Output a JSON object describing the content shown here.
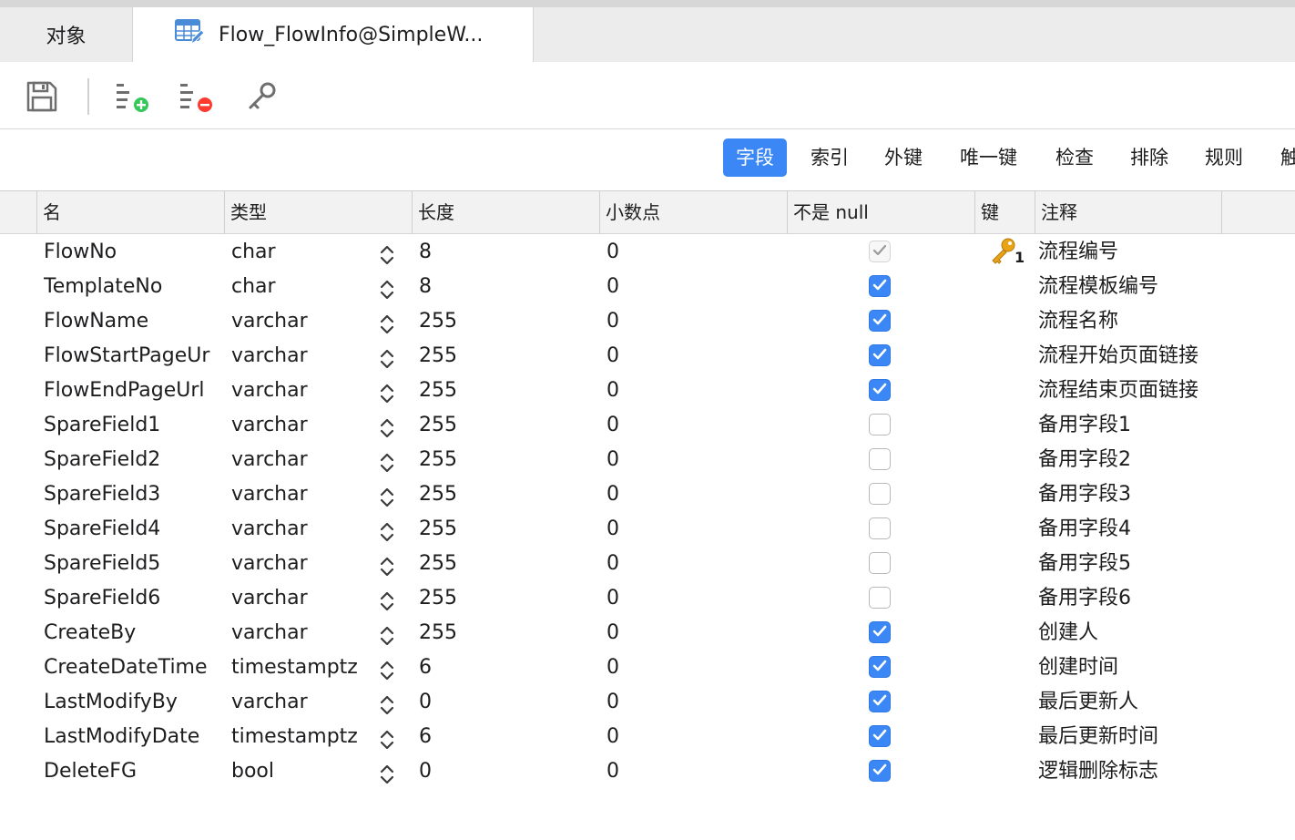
{
  "tabs": [
    {
      "label": "对象",
      "icon": "none"
    },
    {
      "label": "Flow_FlowInfo@SimpleW...",
      "icon": "table-edit-icon"
    }
  ],
  "toolbar": {
    "buttons": [
      {
        "name": "save-button",
        "icon": "save-icon"
      },
      {
        "name": "add-field-button",
        "icon": "add-field-icon"
      },
      {
        "name": "delete-field-button",
        "icon": "delete-field-icon"
      },
      {
        "name": "primary-key-button",
        "icon": "key-icon"
      }
    ]
  },
  "segments": [
    {
      "label": "字段",
      "active": true
    },
    {
      "label": "索引",
      "active": false
    },
    {
      "label": "外键",
      "active": false
    },
    {
      "label": "唯一键",
      "active": false
    },
    {
      "label": "检查",
      "active": false
    },
    {
      "label": "排除",
      "active": false
    },
    {
      "label": "规则",
      "active": false
    },
    {
      "label": "触",
      "active": false
    }
  ],
  "columns": [
    "名",
    "类型",
    "长度",
    "小数点",
    "不是 null",
    "键",
    "注释"
  ],
  "rows": [
    {
      "name": "FlowNo",
      "type": "char",
      "length": "8",
      "decimals": "0",
      "not_null": "disabled",
      "key": "1",
      "comment": "流程编号"
    },
    {
      "name": "TemplateNo",
      "type": "char",
      "length": "8",
      "decimals": "0",
      "not_null": "on",
      "key": "",
      "comment": "流程模板编号"
    },
    {
      "name": "FlowName",
      "type": "varchar",
      "length": "255",
      "decimals": "0",
      "not_null": "on",
      "key": "",
      "comment": "流程名称"
    },
    {
      "name": "FlowStartPageUr",
      "type": "varchar",
      "length": "255",
      "decimals": "0",
      "not_null": "on",
      "key": "",
      "comment": "流程开始页面链接"
    },
    {
      "name": "FlowEndPageUrl",
      "type": "varchar",
      "length": "255",
      "decimals": "0",
      "not_null": "on",
      "key": "",
      "comment": "流程结束页面链接"
    },
    {
      "name": "SpareField1",
      "type": "varchar",
      "length": "255",
      "decimals": "0",
      "not_null": "off",
      "key": "",
      "comment": "备用字段1"
    },
    {
      "name": "SpareField2",
      "type": "varchar",
      "length": "255",
      "decimals": "0",
      "not_null": "off",
      "key": "",
      "comment": "备用字段2"
    },
    {
      "name": "SpareField3",
      "type": "varchar",
      "length": "255",
      "decimals": "0",
      "not_null": "off",
      "key": "",
      "comment": "备用字段3"
    },
    {
      "name": "SpareField4",
      "type": "varchar",
      "length": "255",
      "decimals": "0",
      "not_null": "off",
      "key": "",
      "comment": "备用字段4"
    },
    {
      "name": "SpareField5",
      "type": "varchar",
      "length": "255",
      "decimals": "0",
      "not_null": "off",
      "key": "",
      "comment": "备用字段5"
    },
    {
      "name": "SpareField6",
      "type": "varchar",
      "length": "255",
      "decimals": "0",
      "not_null": "off",
      "key": "",
      "comment": "备用字段6"
    },
    {
      "name": "CreateBy",
      "type": "varchar",
      "length": "255",
      "decimals": "0",
      "not_null": "on",
      "key": "",
      "comment": "创建人"
    },
    {
      "name": "CreateDateTime",
      "type": "timestamptz",
      "length": "6",
      "decimals": "0",
      "not_null": "on",
      "key": "",
      "comment": "创建时间"
    },
    {
      "name": "LastModifyBy",
      "type": "varchar",
      "length": "0",
      "decimals": "0",
      "not_null": "on",
      "key": "",
      "comment": "最后更新人"
    },
    {
      "name": "LastModifyDate",
      "type": "timestamptz",
      "length": "6",
      "decimals": "0",
      "not_null": "on",
      "key": "",
      "comment": "最后更新时间"
    },
    {
      "name": "DeleteFG",
      "type": "bool",
      "length": "0",
      "decimals": "0",
      "not_null": "on",
      "key": "",
      "comment": "逻辑删除标志"
    }
  ],
  "colors": {
    "accent": "#3a87f5",
    "tabbar": "#ececec",
    "key": "#e8a317",
    "add": "#34c759",
    "remove": "#ff3b30"
  }
}
